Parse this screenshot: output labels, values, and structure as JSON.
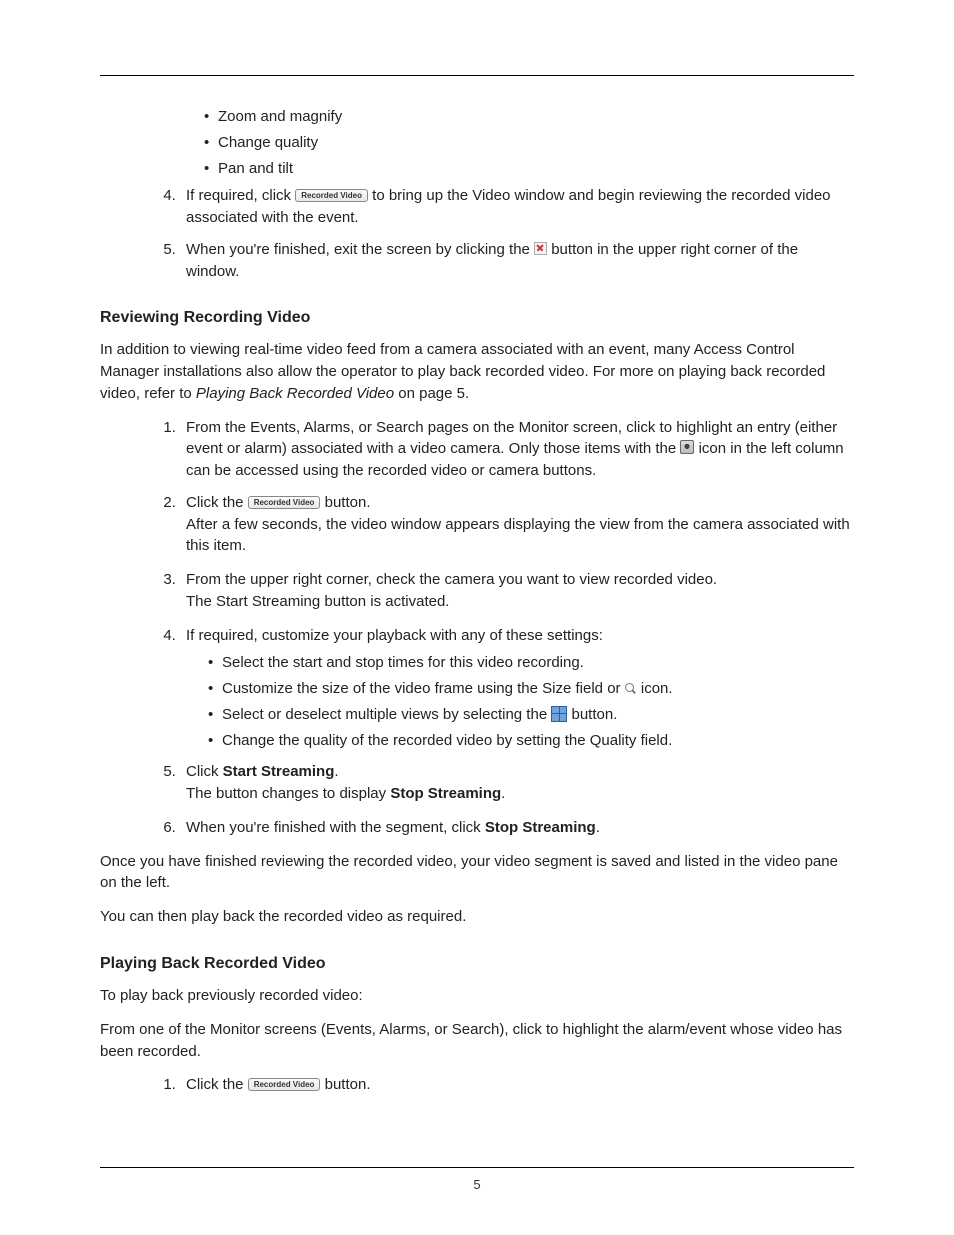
{
  "page_number": "5",
  "top_bullets": [
    "Zoom and magnify",
    "Change quality",
    "Pan and tilt"
  ],
  "btn_label": "Recorded Video",
  "step4_a": "If required, click ",
  "step4_b": " to bring up the Video window and begin reviewing the recorded video associated with the event.",
  "step5_a": "When you're finished, exit the screen by clicking the ",
  "step5_b": " button in the upper right corner of the window.",
  "sec1_title": "Reviewing Recording Video",
  "sec1_p1_a": "In addition to viewing real-time video feed from a camera associated with an event, many Access Control Manager installations also allow the operator to play back recorded video. For more on playing back recorded video, refer to ",
  "sec1_p1_ref": "Playing Back Recorded Video",
  "sec1_p1_b": " on page 5.",
  "s1_1a": "From the Events, Alarms, or Search pages on the Monitor screen, click to highlight an entry (either event or alarm) associated with a video camera. Only those items with the ",
  "s1_1b": " icon in the left column can be accessed using the recorded video or camera buttons.",
  "s1_2a": "Click the ",
  "s1_2b": " button.",
  "s1_2p": "After a few seconds, the video window appears displaying the view from the camera associated with this item.",
  "s1_3": "From the upper right corner, check the camera you want to view recorded video.",
  "s1_3p": "The Start Streaming button is activated.",
  "s1_4": "If required, customize your playback with any of these settings:",
  "s1_4_bullets": {
    "b1": "Select the start and stop times for this video recording.",
    "b2a": "Customize the size of the video frame using the Size field or ",
    "b2b": " icon.",
    "b3a": "Select or deselect multiple views by selecting the ",
    "b3b": " button.",
    "b4": "Change the quality of the recorded video by setting the Quality field."
  },
  "s1_5a": "Click ",
  "s1_5bold": "Start Streaming",
  "s1_5b": ".",
  "s1_5p_a": "The button changes to display ",
  "s1_5p_bold": "Stop Streaming",
  "s1_5p_b": ".",
  "s1_6a": "When you're finished with the segment, click ",
  "s1_6bold": "Stop Streaming",
  "s1_6b": ".",
  "sec1_p2": "Once you have finished reviewing the recorded video, your video segment is saved and listed in the video pane on the left.",
  "sec1_p3": "You can then play back the recorded video as required.",
  "sec2_title": "Playing Back Recorded Video",
  "sec2_p1": "To play back previously recorded video:",
  "sec2_p2": "From one of the Monitor screens (Events, Alarms, or Search), click to highlight the alarm/event whose video has been recorded.",
  "sec2_s1a": "Click the ",
  "sec2_s1b": " button."
}
